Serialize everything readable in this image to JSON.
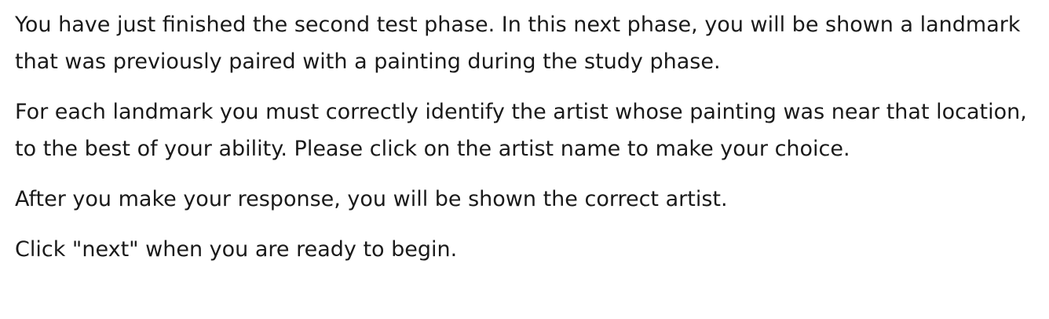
{
  "instructions": {
    "paragraphs": [
      "You have just finished the second test phase. In this next phase, you will be shown a landmark that was previously paired with a painting during the study phase.",
      "For each landmark you must correctly identify the artist whose painting was near that location, to the best of your ability. Please click on the artist name to make your choice.",
      "After you make your response, you will be shown the correct artist.",
      "Click \"next\" when you are ready to begin."
    ]
  }
}
